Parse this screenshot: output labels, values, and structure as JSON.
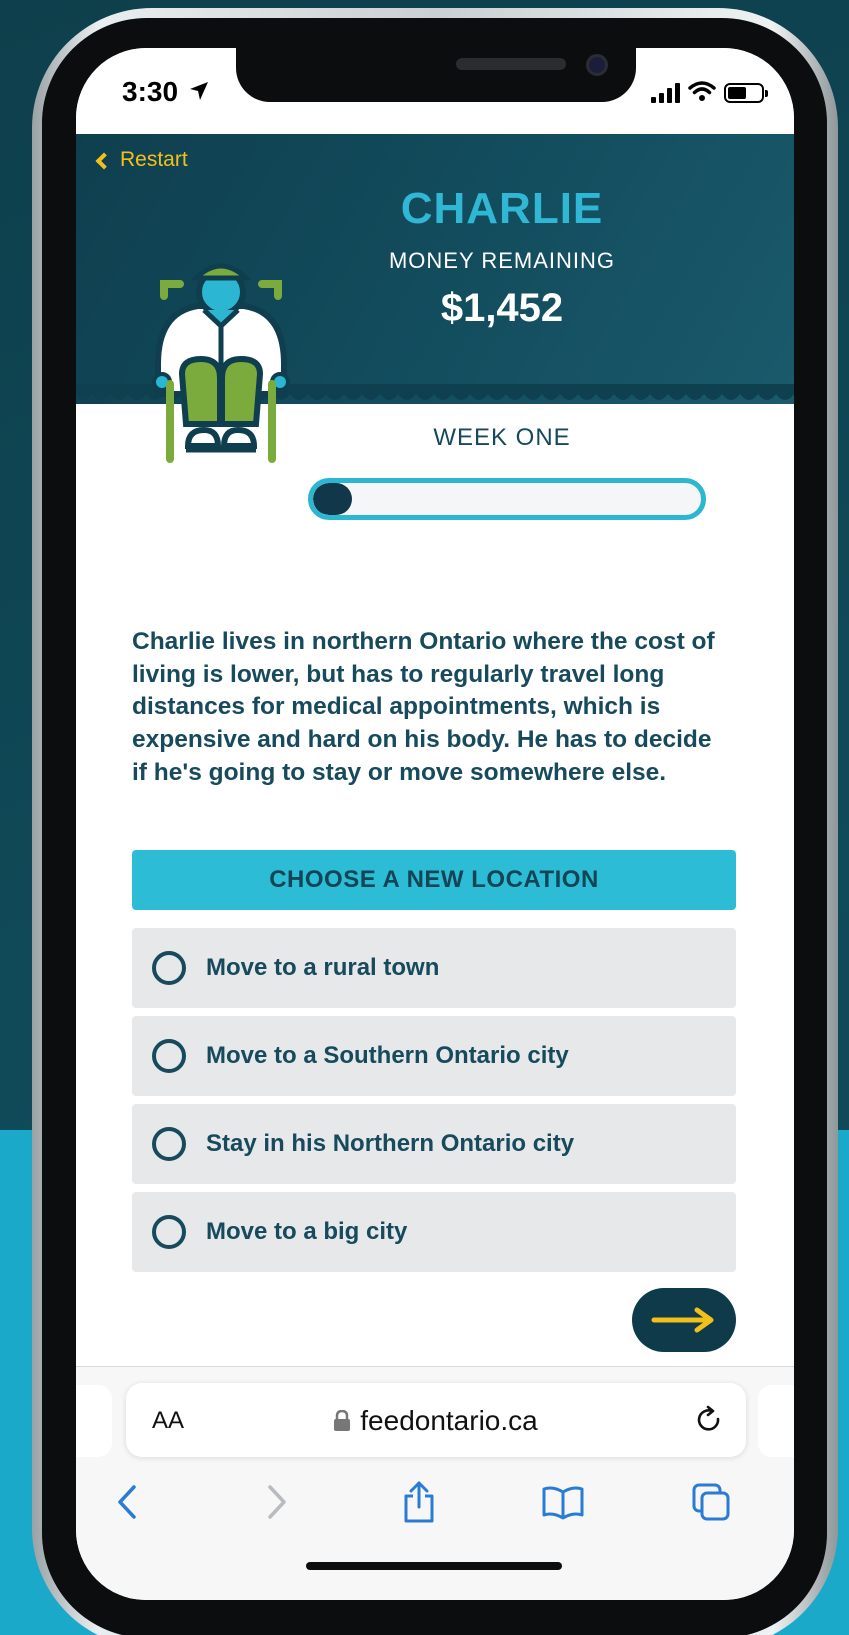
{
  "status_bar": {
    "time": "3:30"
  },
  "header": {
    "restart_label": "Restart",
    "character_name": "CHARLIE",
    "money_label": "MONEY REMAINING",
    "money_value": "$1,452"
  },
  "week": {
    "label": "WEEK ONE",
    "progress_fraction": 0.1
  },
  "description": "Charlie lives in northern Ontario where the cost of living is lower, but has to regularly travel long distances for medical appointments, which is expensive and hard on his body. He has to decide if he's going to stay or move somewhere else.",
  "choices": {
    "header": "CHOOSE A NEW LOCATION",
    "options": [
      {
        "label": "Move to a rural town"
      },
      {
        "label": "Move to a Southern Ontario city"
      },
      {
        "label": "Stay in his Northern Ontario city"
      },
      {
        "label": "Move to a big city"
      }
    ]
  },
  "browser": {
    "text_size_label": "AA",
    "url": "feedontario.ca"
  },
  "colors": {
    "header_bg": "#0f3f4f",
    "accent_cyan": "#2bb6d2",
    "accent_yellow": "#f2c01a",
    "text_dark": "#174a5c",
    "option_bg": "#e7e8ea"
  }
}
